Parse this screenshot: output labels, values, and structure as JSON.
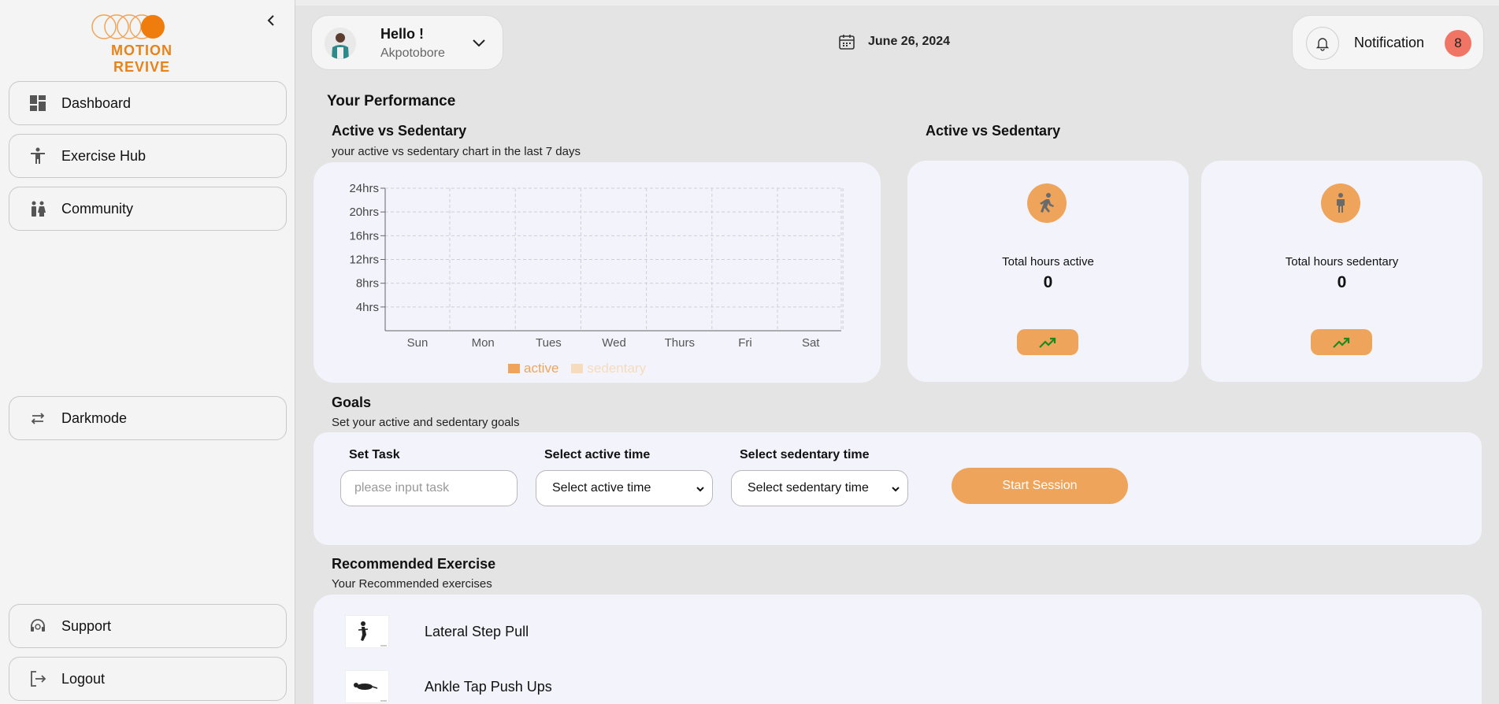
{
  "app": {
    "brand": "MOTION REVIVE",
    "brand_color": "#e8821a",
    "accent": "#eea55b"
  },
  "sidebar": {
    "nav": [
      {
        "label": "Dashboard",
        "icon": "dashboard-icon"
      },
      {
        "label": "Exercise Hub",
        "icon": "person-icon"
      },
      {
        "label": "Community",
        "icon": "people-icon"
      }
    ],
    "darkmode_label": "Darkmode",
    "support_label": "Support",
    "logout_label": "Logout"
  },
  "header": {
    "greeting": "Hello !",
    "username": "Akpotobore",
    "date": "June 26, 2024",
    "notification_label": "Notification",
    "notification_count": "8"
  },
  "performance": {
    "heading": "Your Performance",
    "chart_title": "Active vs Sedentary",
    "chart_subtitle": "your active vs sedentary chart in the last 7 days",
    "stats_title": "Active vs Sedentary",
    "active": {
      "label": "Total hours active",
      "value": "0"
    },
    "sedentary": {
      "label": "Total hours sedentary",
      "value": "0"
    }
  },
  "chart_data": {
    "type": "bar",
    "categories": [
      "Sun",
      "Mon",
      "Tues",
      "Wed",
      "Thurs",
      "Fri",
      "Sat"
    ],
    "y_ticks": [
      "4hrs",
      "8hrs",
      "12hrs",
      "16hrs",
      "20hrs",
      "24hrs"
    ],
    "ylim": [
      0,
      24
    ],
    "grid": true,
    "legend_position": "bottom",
    "series": [
      {
        "name": "active",
        "color": "#eea55b",
        "values": [
          0,
          0,
          0,
          0,
          0,
          0,
          0
        ]
      },
      {
        "name": "sedentary",
        "color": "#f6dcbc",
        "values": [
          0,
          0,
          0,
          0,
          0,
          0,
          0
        ]
      }
    ]
  },
  "goals": {
    "title": "Goals",
    "subtitle": "Set your active and sedentary goals",
    "task_label": "Set Task",
    "task_placeholder": "please input task",
    "active_label": "Select active time",
    "active_value": "Select active time",
    "sedentary_label": "Select sedentary time",
    "sedentary_value": "Select sedentary time",
    "start_label": "Start Session"
  },
  "recommended": {
    "title": "Recommended Exercise",
    "subtitle": "Your Recommended exercises",
    "items": [
      {
        "name": "Lateral Step Pull"
      },
      {
        "name": "Ankle Tap Push Ups"
      }
    ]
  }
}
